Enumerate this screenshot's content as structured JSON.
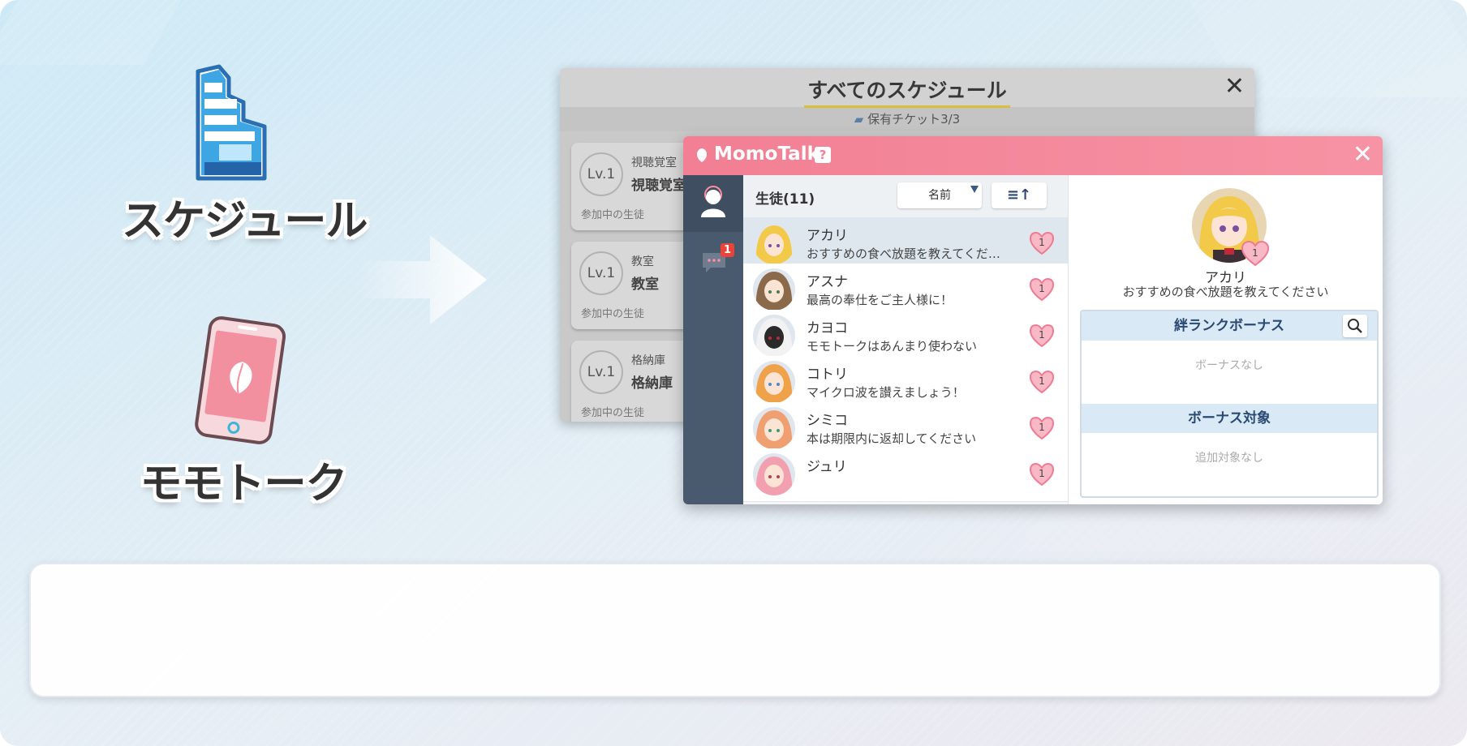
{
  "left": {
    "schedule_label": "スケジュール",
    "momotalk_label": "モモトーク"
  },
  "schedule_window": {
    "title": "すべてのスケジュール",
    "ticket": "保有チケット3/3",
    "cards": [
      {
        "level": "Lv.1",
        "sub": "視聴覚室",
        "name": "視聴覚室",
        "participants_label": "参加中の生徒"
      },
      {
        "level": "Lv.1",
        "sub": "教室",
        "name": "教室",
        "participants_label": "参加中の生徒"
      },
      {
        "level": "Lv.1",
        "sub": "格納庫",
        "name": "格納庫",
        "participants_label": "参加中の生徒"
      }
    ]
  },
  "momotalk": {
    "title": "MomoTalk",
    "help": "?",
    "unread_badge": "1",
    "list_count": "生徒(11)",
    "sort_label": "名前",
    "sort_dir_label": "≡↑",
    "students": [
      {
        "name": "アカリ",
        "message": "おすすめの食べ放題を教えてくださいね",
        "bond": "1",
        "selected": true
      },
      {
        "name": "アスナ",
        "message": "最高の奉仕をご主人様に！",
        "bond": "1"
      },
      {
        "name": "カヨコ",
        "message": "モモトークはあんまり使わない",
        "bond": "1"
      },
      {
        "name": "コトリ",
        "message": "マイクロ波を讃えましょう！",
        "bond": "1"
      },
      {
        "name": "シミコ",
        "message": "本は期限内に返却してください",
        "bond": "1"
      },
      {
        "name": "ジュリ",
        "message": "",
        "bond": "1"
      }
    ],
    "detail": {
      "name": "アカリ",
      "message": "おすすめの食べ放題を教えてください",
      "bond": "1",
      "bonus_header": "絆ランクボーナス",
      "bonus_value": "ボーナスなし",
      "target_header": "ボーナス対象",
      "target_value": "追加対象なし"
    }
  },
  "colors": {
    "momotalk_pink": "#f27f94",
    "sidebar": "#4a5a6e",
    "bonus_header": "#d9e9f5",
    "accent_underline": "#d8c03a"
  }
}
